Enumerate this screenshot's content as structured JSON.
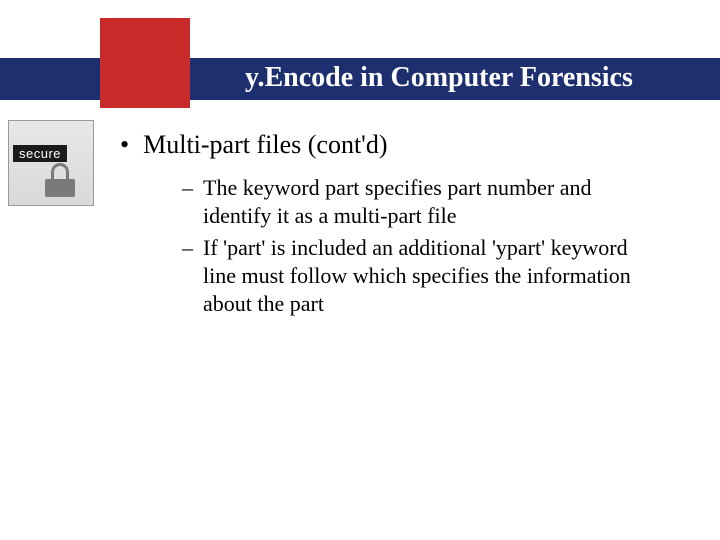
{
  "header": {
    "title": "y.Encode in Computer Forensics"
  },
  "badge": {
    "label": "secure"
  },
  "content": {
    "bullet": "Multi-part files (cont'd)",
    "subitems": [
      "The keyword part specifies part number and identify it as a multi-part file",
      "If 'part' is included an additional 'ypart' keyword line must follow which specifies the information about the part"
    ]
  }
}
